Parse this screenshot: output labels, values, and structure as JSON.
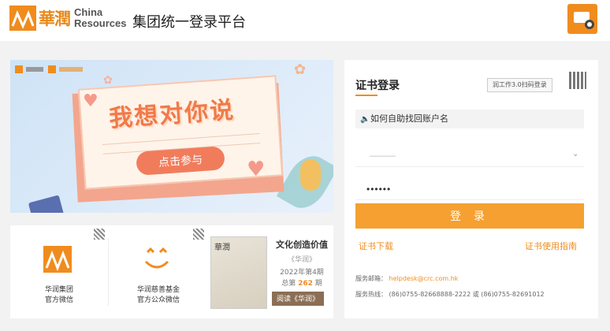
{
  "header": {
    "logo_cn": "華潤",
    "logo_en_line1": "China",
    "logo_en_line2": "Resources",
    "title": "集团统一登录平台"
  },
  "banner": {
    "headline": "我想对你说",
    "cta": "点击参与"
  },
  "qr_cards": [
    {
      "label_line1": "华润集团",
      "label_line2": "官方微信"
    },
    {
      "label_line1": "华润慈善基金",
      "label_line2": "官方公众微信"
    }
  ],
  "magazine": {
    "cover_title": "華潤",
    "heading": "文化创造价值",
    "name": "《华润》",
    "issue": "2022年第4期",
    "total_prefix": "总第",
    "total_number": "262",
    "total_suffix": "期",
    "button": "阅读《华润》"
  },
  "login": {
    "tab_label": "证书登录",
    "scan_tag": "润工作3.0扫码登录",
    "help_text": "如何自助找回账户名",
    "account_value": "———",
    "password_mask": "••••••",
    "submit": "登 录",
    "download_link": "证书下载",
    "guide_link": "证书使用指南",
    "email_label": "服务邮箱：",
    "email_value": "helpdesk@crc.com.hk",
    "phone_label": "服务热线：",
    "phone_value": "(86)0755-82668888-2222 或 (86)0755-82691012"
  },
  "colors": {
    "brand_orange": "#f08c1e",
    "button_orange": "#f5a030"
  }
}
